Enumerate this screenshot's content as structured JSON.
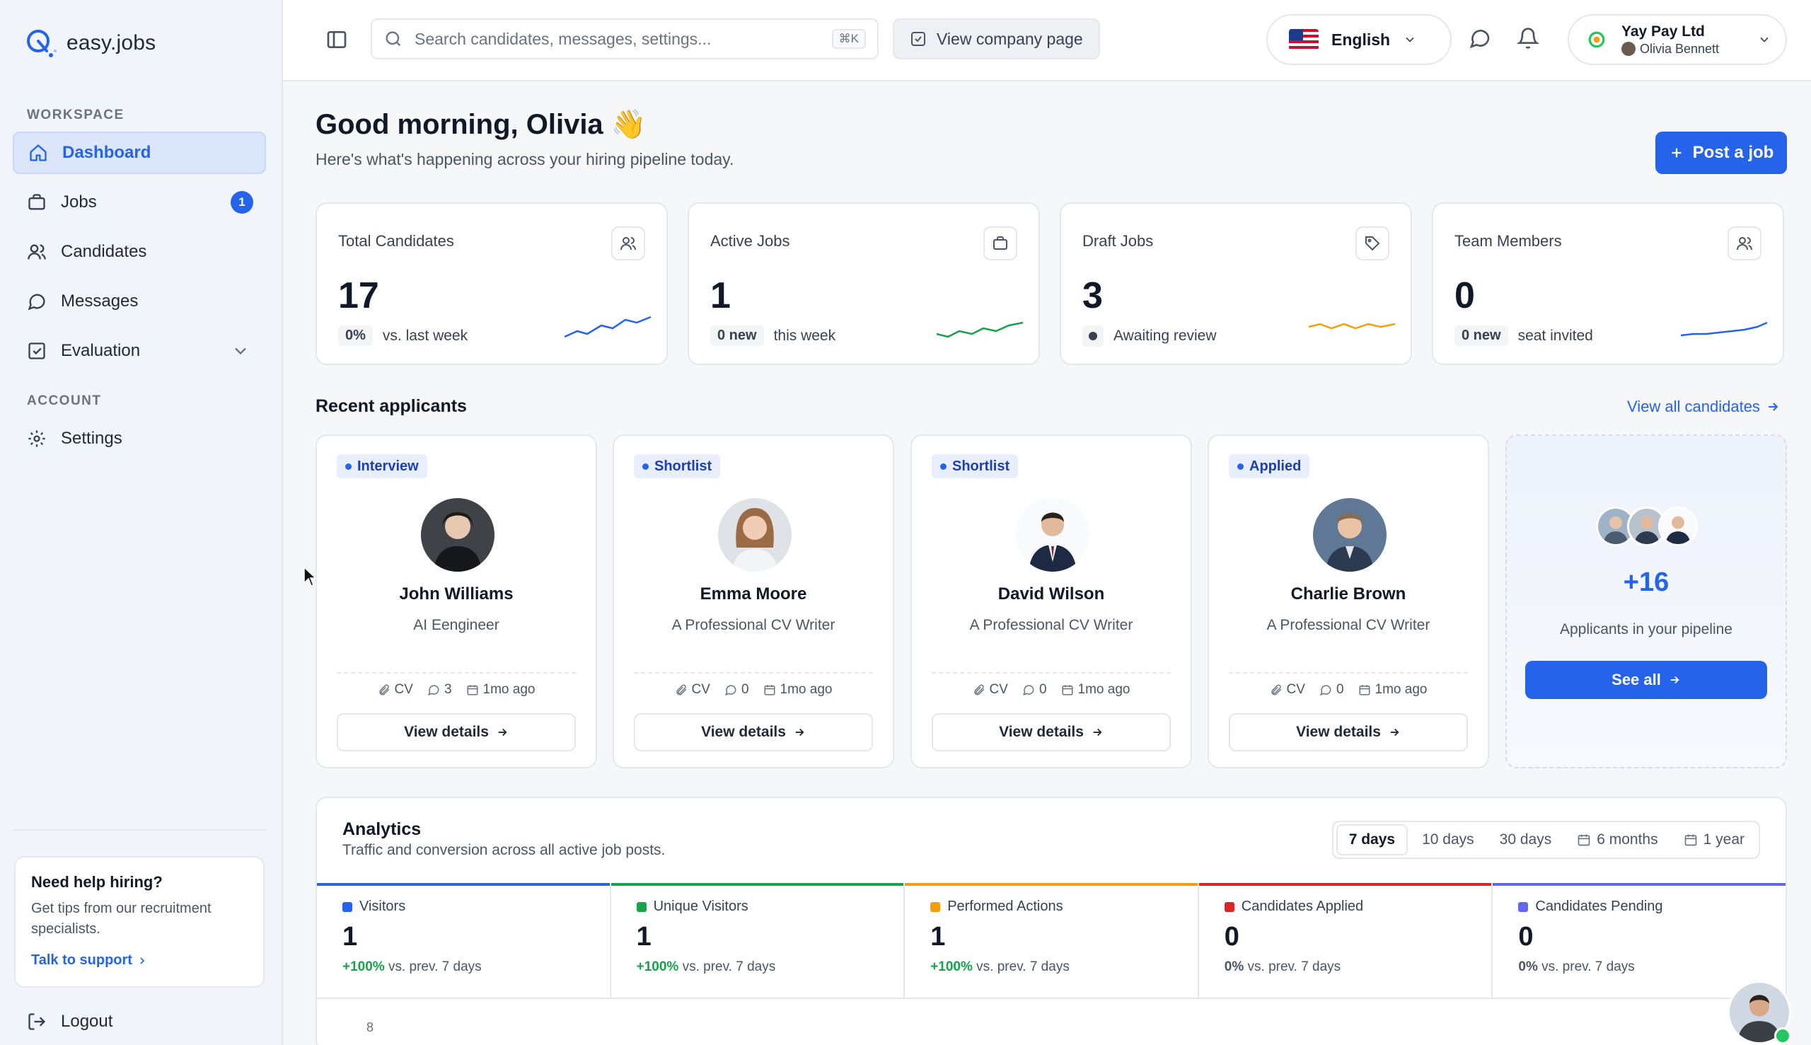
{
  "app": {
    "name": "easy.jobs"
  },
  "sidebar": {
    "workspace_label": "WORKSPACE",
    "account_label": "ACCOUNT",
    "items": [
      {
        "label": "Dashboard",
        "icon": "home-icon",
        "active": true
      },
      {
        "label": "Jobs",
        "icon": "briefcase-icon",
        "badge": "1"
      },
      {
        "label": "Candidates",
        "icon": "users-icon"
      },
      {
        "label": "Messages",
        "icon": "chat-icon"
      },
      {
        "label": "Evaluation",
        "icon": "checklist-icon",
        "expandable": true
      }
    ],
    "settings_label": "Settings",
    "help": {
      "title": "Need help hiring?",
      "text": "Get tips from our recruitment specialists.",
      "link": "Talk to support"
    },
    "logout_label": "Logout"
  },
  "topbar": {
    "search_placeholder": "Search candidates, messages, settings...",
    "search_shortcut": "⌘K",
    "view_company": "View company page",
    "language": "English",
    "company": "Yay Pay Ltd",
    "user": "Olivia Bennett"
  },
  "header": {
    "greeting": "Good morning, Olivia 👋",
    "subtitle": "Here's what's happening across your hiring pipeline today.",
    "post_job": "Post a job"
  },
  "stats": [
    {
      "title": "Total Candidates",
      "value": "17",
      "pill": "0%",
      "note": "vs. last week",
      "icon": "users-icon",
      "color": "#2563eb"
    },
    {
      "title": "Active Jobs",
      "value": "1",
      "pill": "0 new",
      "note": "this week",
      "icon": "briefcase-icon",
      "color": "#16a34a"
    },
    {
      "title": "Draft Jobs",
      "value": "3",
      "pill": "",
      "note": "Awaiting review",
      "icon": "tag-icon",
      "color": "#f59e0b"
    },
    {
      "title": "Team Members",
      "value": "0",
      "pill": "0 new",
      "note": "seat invited",
      "icon": "users-icon",
      "color": "#2563eb"
    }
  ],
  "recent": {
    "title": "Recent applicants",
    "view_all": "View all candidates",
    "candidates": [
      {
        "status": "Interview",
        "name": "John Williams",
        "role": "AI Eengineer",
        "cv": "CV",
        "comments": "3",
        "time": "1mo ago",
        "action": "View details"
      },
      {
        "status": "Shortlist",
        "name": "Emma Moore",
        "role": "A Professional CV Writer",
        "cv": "CV",
        "comments": "0",
        "time": "1mo ago",
        "action": "View details"
      },
      {
        "status": "Shortlist",
        "name": "David Wilson",
        "role": "A Professional CV Writer",
        "cv": "CV",
        "comments": "0",
        "time": "1mo ago",
        "action": "View details"
      },
      {
        "status": "Applied",
        "name": "Charlie Brown",
        "role": "A Professional CV Writer",
        "cv": "CV",
        "comments": "0",
        "time": "1mo ago",
        "action": "View details"
      }
    ],
    "more_count": "+16",
    "more_text": "Applicants in your pipeline",
    "see_all": "See all"
  },
  "analytics": {
    "title": "Analytics",
    "subtitle": "Traffic and conversion across all active job posts.",
    "ranges": [
      "7 days",
      "10 days",
      "30 days",
      "6 months",
      "1 year"
    ],
    "active_range": "7 days",
    "metrics": [
      {
        "label": "Visitors",
        "value": "1",
        "delta": "+100%",
        "compare": "vs. prev. 7 days",
        "color": "#2563eb",
        "up": true
      },
      {
        "label": "Unique Visitors",
        "value": "1",
        "delta": "+100%",
        "compare": "vs. prev. 7 days",
        "color": "#16a34a",
        "up": true
      },
      {
        "label": "Performed Actions",
        "value": "1",
        "delta": "+100%",
        "compare": "vs. prev. 7 days",
        "color": "#f59e0b",
        "up": true
      },
      {
        "label": "Candidates Applied",
        "value": "0",
        "delta": "0%",
        "compare": "vs. prev. 7 days",
        "color": "#dc2626",
        "up": false
      },
      {
        "label": "Candidates Pending",
        "value": "0",
        "delta": "0%",
        "compare": "vs. prev. 7 days",
        "color": "#6366f1",
        "up": false
      }
    ],
    "y_tick": "8"
  }
}
